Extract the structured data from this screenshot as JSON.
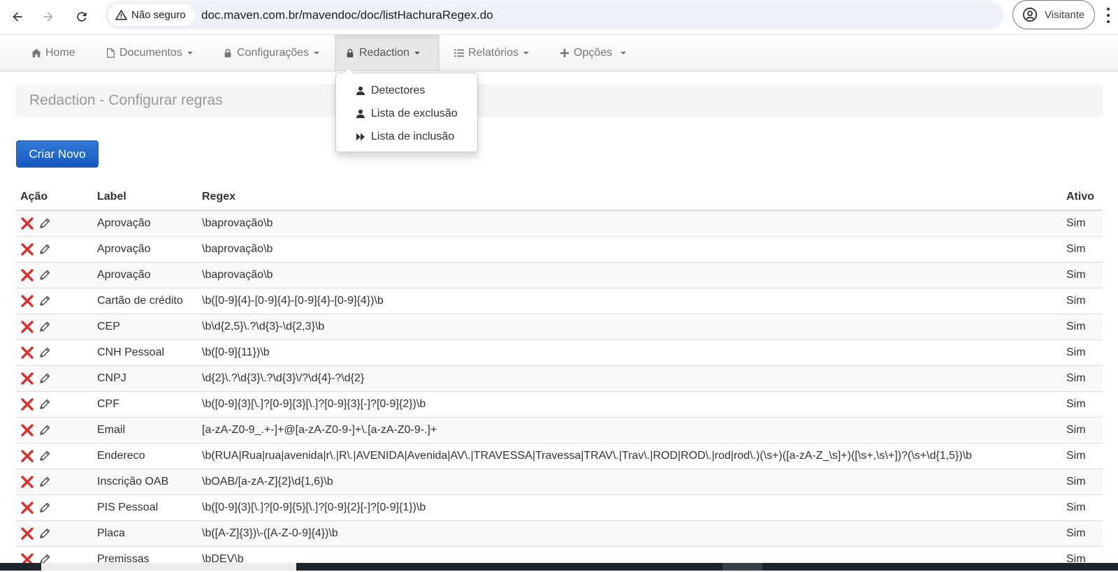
{
  "browser": {
    "security_label": "Não seguro",
    "url": "doc.maven.com.br/mavendoc/doc/listHachuraRegex.do",
    "profile_label": "Visitante"
  },
  "navbar": {
    "items": [
      {
        "label": "Home",
        "icon": "home-icon"
      },
      {
        "label": "Documentos",
        "icon": "file-icon"
      },
      {
        "label": "Configurações",
        "icon": "lock-icon"
      },
      {
        "label": "Redaction",
        "icon": "lock-icon"
      },
      {
        "label": "Relatórios",
        "icon": "list-icon"
      },
      {
        "label": "Opções",
        "icon": "plus-icon"
      }
    ]
  },
  "dropdown": {
    "items": [
      {
        "label": "Detectores",
        "icon": "user-icon"
      },
      {
        "label": "Lista de exclusão",
        "icon": "user-icon"
      },
      {
        "label": "Lista de inclusão",
        "icon": "fast-forward-icon"
      }
    ]
  },
  "page": {
    "title": "Redaction - Configurar regras",
    "create_button": "Criar Novo"
  },
  "table": {
    "headers": [
      "Ação",
      "Label",
      "Regex",
      "Ativo"
    ],
    "rows": [
      {
        "label": "Aprovação",
        "regex": "\\baprovação\\b",
        "ativo": "Sim"
      },
      {
        "label": "Aprovação",
        "regex": "\\baprovação\\b",
        "ativo": "Sim"
      },
      {
        "label": "Aprovação",
        "regex": "\\baprovação\\b",
        "ativo": "Sim"
      },
      {
        "label": "Cartão de crédito",
        "regex": "\\b([0-9]{4}-[0-9]{4}-[0-9]{4}-[0-9]{4})\\b",
        "ativo": "Sim"
      },
      {
        "label": "CEP",
        "regex": "\\b\\d{2,5}\\.?\\d{3}-\\d{2,3}\\b",
        "ativo": "Sim"
      },
      {
        "label": "CNH Pessoal",
        "regex": "\\b([0-9]{11})\\b",
        "ativo": "Sim"
      },
      {
        "label": "CNPJ",
        "regex": "\\d{2}\\.?\\d{3}\\.?\\d{3}\\/?\\d{4}-?\\d{2}",
        "ativo": "Sim"
      },
      {
        "label": "CPF",
        "regex": "\\b([0-9]{3}[\\.]?[0-9]{3}[\\.]?[0-9]{3}[-]?[0-9]{2})\\b",
        "ativo": "Sim"
      },
      {
        "label": "Email",
        "regex": "[a-zA-Z0-9_.+-]+@[a-zA-Z0-9-]+\\.[a-zA-Z0-9-.]+",
        "ativo": "Sim"
      },
      {
        "label": "Endereco",
        "regex": "\\b(RUA|Rua|rua|avenida|r\\.|R\\.|AVENIDA|Avenida|AV\\.|TRAVESSA|Travessa|TRAV\\.|Trav\\.|ROD|ROD\\.|rod|rod\\.)(\\s+)([a-zA-Z_\\s]+)([\\s+,\\s\\+])?(\\s+\\d{1,5})\\b",
        "ativo": "Sim"
      },
      {
        "label": "Inscrição OAB",
        "regex": "\\bOAB/[a-zA-Z]{2}\\d{1,6}\\b",
        "ativo": "Sim"
      },
      {
        "label": "PIS Pessoal",
        "regex": "\\b([0-9]{3}[\\.]?[0-9]{5}[\\.]?[0-9]{2}[-]?[0-9]{1})\\b",
        "ativo": "Sim"
      },
      {
        "label": "Placa",
        "regex": "\\b([A-Z]{3})\\-([A-Z-0-9]{4})\\b",
        "ativo": "Sim"
      },
      {
        "label": "Premissas",
        "regex": "\\bDEV\\b",
        "ativo": "Sim"
      }
    ]
  },
  "colors": {
    "primary": "#1659c2",
    "delete": "#d9302c",
    "header_bg": "#f5f5f5"
  }
}
